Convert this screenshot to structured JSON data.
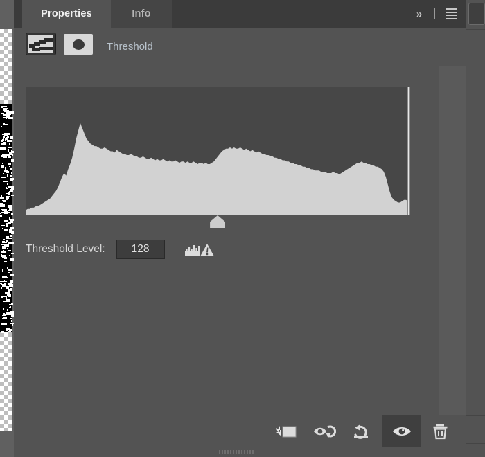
{
  "window": {
    "tabs": [
      {
        "label": "Properties",
        "active": true
      },
      {
        "label": "Info",
        "active": false
      }
    ],
    "collapse_label": "»",
    "menu_icon": "hamburger-menu-icon"
  },
  "adjustment": {
    "title": "Threshold",
    "layer_thumbnail_icon": "threshold-adjustment-icon",
    "mask_thumbnail_icon": "layer-mask-icon"
  },
  "histogram": {
    "slider_position_pct": 50.2,
    "end_marker": true,
    "points": [
      0.04,
      0.05,
      0.05,
      0.06,
      0.06,
      0.07,
      0.07,
      0.08,
      0.09,
      0.1,
      0.11,
      0.12,
      0.13,
      0.15,
      0.17,
      0.19,
      0.22,
      0.26,
      0.3,
      0.33,
      0.31,
      0.36,
      0.4,
      0.45,
      0.52,
      0.6,
      0.66,
      0.72,
      0.68,
      0.64,
      0.6,
      0.58,
      0.56,
      0.55,
      0.54,
      0.54,
      0.53,
      0.52,
      0.52,
      0.53,
      0.52,
      0.51,
      0.5,
      0.5,
      0.49,
      0.51,
      0.5,
      0.49,
      0.48,
      0.48,
      0.47,
      0.47,
      0.48,
      0.47,
      0.46,
      0.46,
      0.45,
      0.45,
      0.46,
      0.45,
      0.44,
      0.44,
      0.45,
      0.44,
      0.43,
      0.44,
      0.43,
      0.43,
      0.44,
      0.43,
      0.42,
      0.43,
      0.42,
      0.42,
      0.43,
      0.42,
      0.41,
      0.42,
      0.42,
      0.41,
      0.42,
      0.41,
      0.41,
      0.42,
      0.41,
      0.4,
      0.41,
      0.41,
      0.4,
      0.41,
      0.4,
      0.4,
      0.41,
      0.42,
      0.44,
      0.46,
      0.48,
      0.5,
      0.51,
      0.52,
      0.52,
      0.53,
      0.52,
      0.53,
      0.52,
      0.52,
      0.53,
      0.52,
      0.51,
      0.52,
      0.51,
      0.5,
      0.51,
      0.5,
      0.49,
      0.5,
      0.49,
      0.48,
      0.48,
      0.47,
      0.47,
      0.46,
      0.46,
      0.45,
      0.45,
      0.44,
      0.44,
      0.43,
      0.43,
      0.42,
      0.42,
      0.41,
      0.41,
      0.4,
      0.4,
      0.39,
      0.39,
      0.38,
      0.38,
      0.37,
      0.37,
      0.36,
      0.36,
      0.35,
      0.35,
      0.35,
      0.34,
      0.34,
      0.34,
      0.33,
      0.33,
      0.33,
      0.34,
      0.33,
      0.33,
      0.32,
      0.33,
      0.34,
      0.35,
      0.36,
      0.37,
      0.38,
      0.39,
      0.4,
      0.41,
      0.41,
      0.42,
      0.41,
      0.41,
      0.4,
      0.4,
      0.39,
      0.39,
      0.38,
      0.38,
      0.37,
      0.36,
      0.34,
      0.3,
      0.24,
      0.18,
      0.14,
      0.12,
      0.11,
      0.1,
      0.1,
      0.11,
      0.12,
      0.12,
      0.11
    ]
  },
  "threshold_level": {
    "label": "Threshold Level:",
    "value": "128",
    "warning_icon": "histogram-warning-icon"
  },
  "footer": {
    "buttons": [
      {
        "name": "clip-to-layer-button",
        "icon": "clip-to-layer-icon",
        "active": false
      },
      {
        "name": "view-previous-state-button",
        "icon": "eye-with-arrow-icon",
        "active": false
      },
      {
        "name": "reset-adjustment-button",
        "icon": "reset-arrow-icon",
        "active": false
      },
      {
        "name": "toggle-layer-visibility-button",
        "icon": "eye-icon",
        "active": true
      },
      {
        "name": "delete-adjustment-layer-button",
        "icon": "trash-icon",
        "active": false
      }
    ]
  },
  "colors": {
    "panel_bg": "#535353",
    "tabbar_bg": "#3b3b3b",
    "histogram_bg": "#474747",
    "histogram_fill": "#d2d2d2",
    "title_text": "#b9c3cc",
    "field_bg": "#3d3d3d"
  }
}
